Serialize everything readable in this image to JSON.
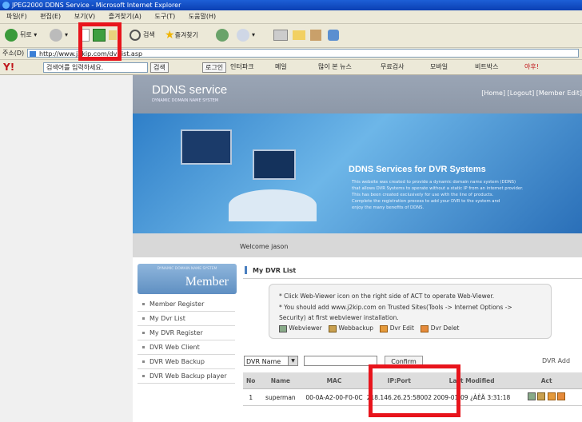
{
  "window": {
    "title": "JPEG2000 DDNS Service - Microsoft Internet Explorer"
  },
  "menu": {
    "items": [
      "파일(F)",
      "편집(E)",
      "보기(V)",
      "즐겨찾기(A)",
      "도구(T)",
      "도움말(H)"
    ]
  },
  "toolbar": {
    "back": "뒤로",
    "search": "검색",
    "favorites": "즐겨찾기"
  },
  "address": {
    "label": "주소(D)",
    "url": "http://www.j2kip.com/dvrlist.asp"
  },
  "yahoo": {
    "search_placeholder": "검색어를 입력하세요.",
    "search_btn": "검색",
    "login": "로그인",
    "items": [
      "인터파크",
      "메일",
      "많이 본 뉴스",
      "무료검사",
      "모바일",
      "비트박스",
      "야후!"
    ]
  },
  "site": {
    "logo_title": "DDNS service",
    "logo_subtitle": "DYNAMIC DOMAIN NAME SYSTEM",
    "top_links": "[Home] [Logout] [Member Edit]",
    "banner_title": "DDNS Services for DVR Systems",
    "banner_text": [
      "This website was created to provide a dynamic domain name system (DDNS)",
      "that allows DVR Systems to operate without a static IP from an internet provider.",
      "This has been created exclusively for use with the line of products.",
      "Complete the registration process to add your DVR to the system and",
      "enjoy the many benefits of DDNS."
    ],
    "welcome": "Welcome jason",
    "member_box_small": "DYNAMIC DOMAIN NAME SYSTEM",
    "member_box_title": "Member",
    "sidebar": [
      "Member Register",
      "My Dvr List",
      "My DVR Register",
      "DVR Web Client",
      "DVR Web Backup",
      "DVR Web Backup player"
    ],
    "section_title": "My DVR List",
    "info": [
      "* Click Web-Viewer icon on the right side of ACT to operate Web-Viewer.",
      "* You should add www.j2kip.com on Trusted Sites(Tools -> Internet Options ->",
      "Security) at first webviewer installation."
    ],
    "legend": [
      "Webviewer",
      "Webbackup",
      "Dvr Edit",
      "Dvr Delet"
    ],
    "filter_select": "DVR Name",
    "confirm_btn": "Confirm",
    "dvr_add": "DVR Add",
    "table_headers": [
      "No",
      "Name",
      "MAC",
      "IP:Port",
      "Last Modified",
      "Act"
    ],
    "rows": [
      {
        "no": "1",
        "name": "superman",
        "mac": "00-0A-A2-00-F0-0C",
        "ip": "218.146.26.25:58002",
        "modified": "2009-01-09 ¿ÀÈÄ 3:31:18"
      }
    ]
  },
  "colors": {
    "highlight": "#e8141c",
    "titlebar": "#0b3fb3"
  }
}
